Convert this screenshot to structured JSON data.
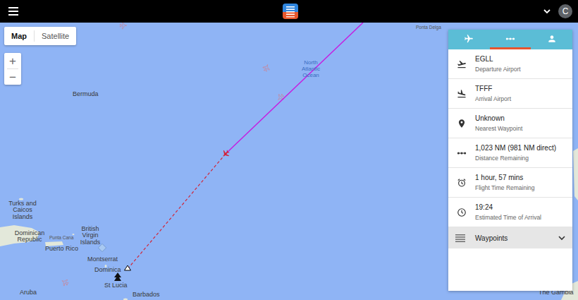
{
  "top_bar": {
    "avatar": "C"
  },
  "map": {
    "view_toggle": [
      {
        "label": "Map",
        "selected": true
      },
      {
        "label": "Satellite",
        "selected": false
      }
    ],
    "zoom": [
      "+",
      "−"
    ],
    "labels": [
      {
        "text": "Ponta Delga",
        "kind": "small"
      },
      {
        "text": "North Atlantic Ocean",
        "kind": "ocean"
      },
      {
        "text": "Bermuda",
        "kind": "place"
      },
      {
        "text": "Turks and Caicos Islands",
        "kind": "place"
      },
      {
        "text": "Dominican Republic",
        "kind": "place"
      },
      {
        "text": "Punta Cana",
        "kind": "small"
      },
      {
        "text": "Puerto Rico",
        "kind": "place"
      },
      {
        "text": "British Virgin Islands",
        "kind": "place"
      },
      {
        "text": "Montserrat",
        "kind": "place"
      },
      {
        "text": "Dominica",
        "kind": "place"
      },
      {
        "text": "St Lucia",
        "kind": "place"
      },
      {
        "text": "Barbados",
        "kind": "place"
      },
      {
        "text": "Aruba",
        "kind": "place"
      },
      {
        "text": "The Gambia",
        "kind": "place"
      }
    ]
  },
  "panel": {
    "tabs": [
      {
        "kind": "flight",
        "selected": false
      },
      {
        "kind": "route",
        "selected": true
      },
      {
        "kind": "pilot",
        "selected": false
      }
    ],
    "rows": [
      {
        "kind": "departure",
        "value": "EGLL",
        "label": "Departure Airport"
      },
      {
        "kind": "arrival",
        "value": "TFFF",
        "label": "Arrival Airport"
      },
      {
        "kind": "waypoint",
        "value": "Unknown",
        "label": "Nearest Waypoint"
      },
      {
        "kind": "distance",
        "value": "1,023 NM (981 NM direct)",
        "label": "Distance Remaining"
      },
      {
        "kind": "timer",
        "value": "1 hour, 57 mins",
        "label": "Flight Time Remaining"
      },
      {
        "kind": "eta",
        "value": "19:24",
        "label": "Estimated Time of Arrival"
      }
    ],
    "waypoints": {
      "label": "Waypoints",
      "expanded": false
    }
  }
}
